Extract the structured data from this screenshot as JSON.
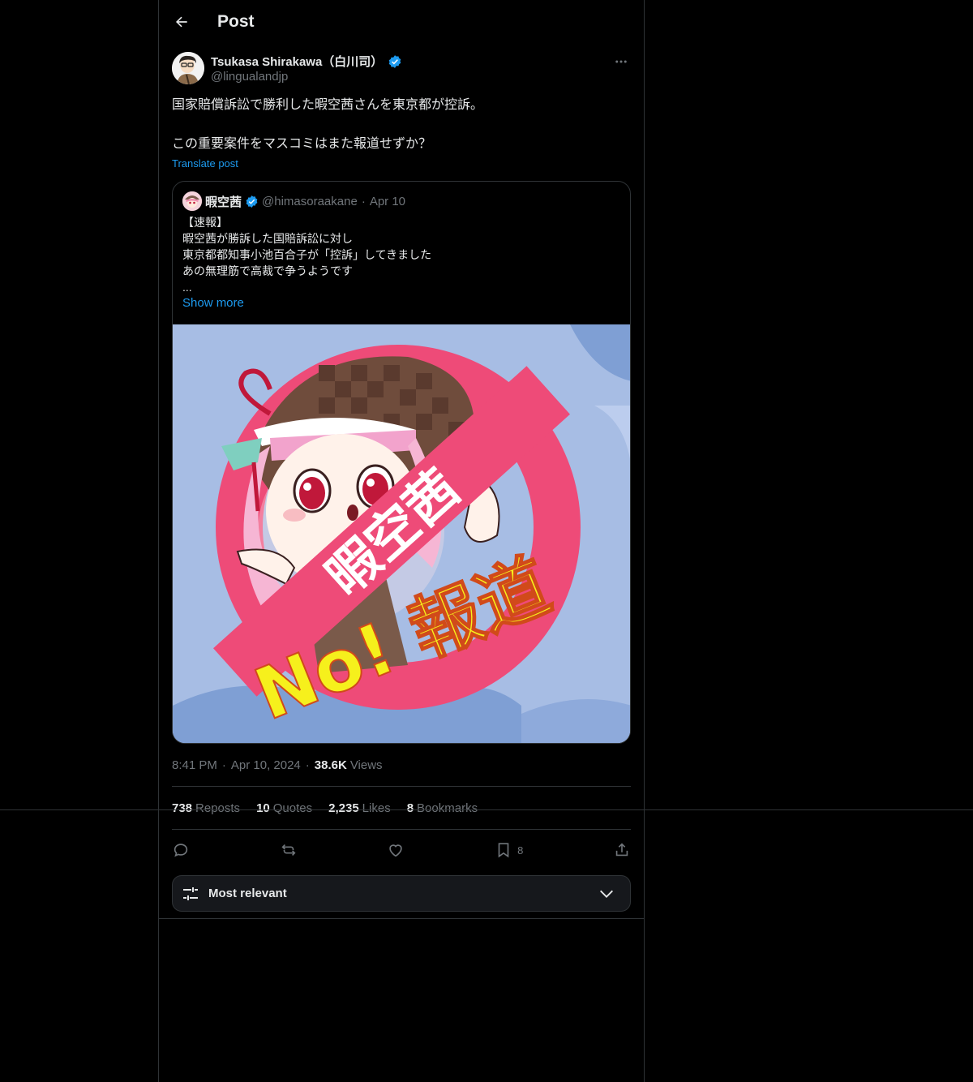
{
  "header": {
    "title": "Post"
  },
  "post": {
    "author_name": "Tsukasa Shirakawa（白川司）",
    "author_handle": "@lingualandjp",
    "text_line1": "国家賠償訴訟で勝利した暇空茜さんを東京都が控訴。",
    "text_line2": "",
    "text_line3": "この重要案件をマスコミはまた報道せずか？",
    "translate_label": "Translate post",
    "time": "8:41 PM",
    "date": "Apr 10, 2024",
    "views_count": "38.6K",
    "views_label": "Views"
  },
  "quote": {
    "name": "暇空茜",
    "handle": "@himasoraakane",
    "dot": "·",
    "date": "Apr 10",
    "lines": [
      "【速報】",
      "暇空茜が勝訴した国賠訴訟に対し",
      "東京都都知事小池百合子が「控訴」してきました",
      "あの無理筋で高裁で争うようです",
      "..."
    ],
    "show_more": "Show more",
    "image": {
      "banner_text": "暇空茜",
      "stamp_text": "No! 報道",
      "colors": {
        "background": "#a7bde4",
        "ring": "#ee4b78",
        "stamp": "#f6f01c"
      }
    }
  },
  "meta_sep": "·",
  "stats": [
    {
      "num": "738",
      "label": "Reposts"
    },
    {
      "num": "10",
      "label": "Quotes"
    },
    {
      "num": "2,235",
      "label": "Likes"
    },
    {
      "num": "8",
      "label": "Bookmarks"
    }
  ],
  "actions": {
    "bookmark_count": "8"
  },
  "sort": {
    "label": "Most relevant"
  },
  "colors": {
    "accent": "#1d9bf0",
    "muted": "#71767b",
    "border": "#2f3336"
  }
}
